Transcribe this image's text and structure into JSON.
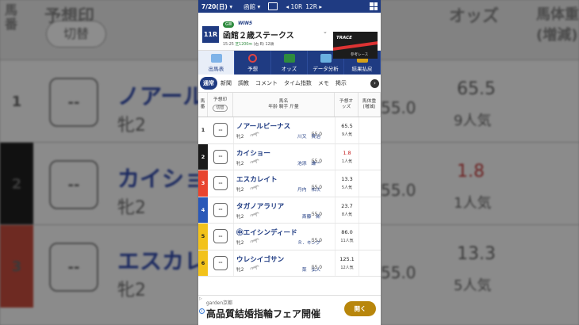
{
  "topbar": {
    "date": "7/20(日)",
    "venue": "函館",
    "prev_race": "10R",
    "next_race": "12R"
  },
  "race": {
    "number": "11R",
    "grade": "GⅢ",
    "win5": "WIN5",
    "name": "函館２歳ステークス",
    "time": "15:25",
    "surface": "芝1200m",
    "detail": "(右 B) 12頭",
    "banner_title": "TRACE",
    "banner_sub": "参考レース"
  },
  "menu": [
    {
      "label": "出馬表",
      "active": true
    },
    {
      "label": "予想",
      "active": false
    },
    {
      "label": "オッズ",
      "active": false
    },
    {
      "label": "データ分析",
      "active": false
    },
    {
      "label": "結果払戻",
      "active": false
    }
  ],
  "subtabs": [
    "通常",
    "新聞",
    "調教",
    "コメント",
    "タイム指数",
    "メモ",
    "掲示"
  ],
  "table_header": {
    "num": "馬番",
    "pred": "予想印",
    "pred_switch": "切替",
    "name_top": "馬名",
    "name_bottom": "年齢 騎手 斤量",
    "odds": "予想オッズ",
    "weight": "馬体重(増減)"
  },
  "horses": [
    {
      "num": "1",
      "name": "ノアールビーナス",
      "sex_age": "牝2",
      "jockey": "川又　賢治",
      "weight": "55.0",
      "odds": "65.5",
      "pop": "9人気",
      "odds_red": false
    },
    {
      "num": "2",
      "name": "カイショー",
      "sex_age": "牝2",
      "jockey": "池添　謙一",
      "weight": "55.0",
      "odds": "1.8",
      "pop": "1人気",
      "odds_red": true
    },
    {
      "num": "3",
      "name": "エスカレイト",
      "sex_age": "牝2",
      "jockey": "丹内　祐次",
      "weight": "55.0",
      "odds": "13.3",
      "pop": "5人気",
      "odds_red": false
    },
    {
      "num": "4",
      "name": "タガノアラリア",
      "sex_age": "牝2",
      "jockey": "斎藤　新",
      "weight": "55.0",
      "odds": "23.7",
      "pop": "8人気",
      "odds_red": false
    },
    {
      "num": "5",
      "name": "㊥エイシンディード",
      "sex_age": "牝2",
      "jockey": "Ｒ．キング",
      "weight": "55.0",
      "odds": "86.0",
      "pop": "11人気",
      "odds_red": false
    },
    {
      "num": "6",
      "name": "ウレシイゴサン",
      "sex_age": "牝2",
      "jockey": "菜　弘人",
      "weight": "55.0",
      "odds": "125.1",
      "pop": "12人気",
      "odds_red": false
    }
  ],
  "pred_placeholder": "--",
  "ad": {
    "source": "garden京都",
    "title": "高品質結婚指輪フェア開催",
    "button": "開く"
  },
  "background": {
    "left_header": "予想印",
    "left_header_switch": "切替",
    "left_num_header": "馬番",
    "right_header_odds": "オッズ",
    "right_header_weight": "馬体重(増減)",
    "left_rows": [
      {
        "num": "1",
        "pred": "--",
        "name": "ノアール",
        "sub": "牝2"
      },
      {
        "num": "2",
        "pred": "--",
        "name": "カイショ",
        "sub": "牝2"
      },
      {
        "num": "3",
        "pred": "--",
        "name": "エスカレ",
        "sub": "牝2"
      }
    ],
    "right_rows": [
      {
        "odds": "65.5",
        "pop": "9人気",
        "wt": "55.0"
      },
      {
        "odds": "1.8",
        "pop": "1人気",
        "wt": "55.0"
      },
      {
        "odds": "13.3",
        "pop": "5人気",
        "wt": "55.0"
      }
    ]
  },
  "colors": {
    "brand": "#1f3b82",
    "post_1": "#ffffff",
    "post_2": "#1a1a1a",
    "post_3": "#e8442e",
    "post_4": "#2a58b8",
    "post_5": "#f2c21b",
    "post_6": "#f2c21b",
    "odds_favorite": "#c41a1a"
  }
}
